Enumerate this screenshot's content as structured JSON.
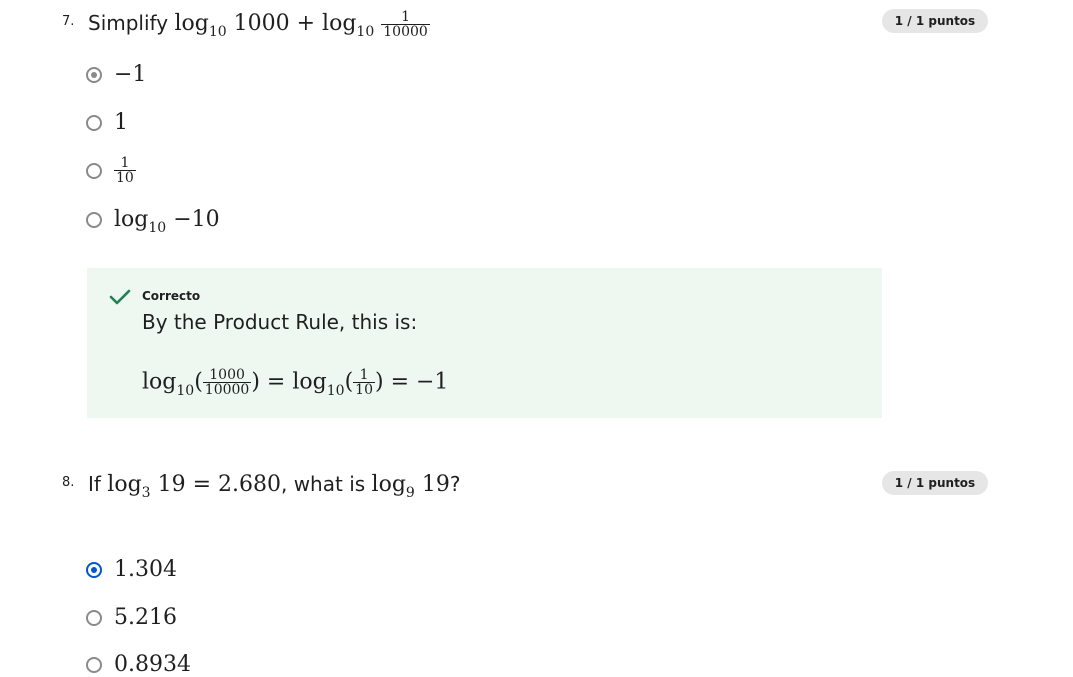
{
  "q7": {
    "number": "7.",
    "prefix": "Simplify ",
    "log_word": "log",
    "log_base": "10",
    "term1": " 1000 + ",
    "frac_num": "1",
    "frac_den": "10000",
    "points": "1 / 1 puntos",
    "options": [
      {
        "label": "−1",
        "selected": true
      },
      {
        "label": "1",
        "selected": false
      },
      {
        "frac_num": "1",
        "frac_den": "10",
        "selected": false
      },
      {
        "log_word": "log",
        "log_base": "10",
        "rest": " −10",
        "selected": false
      }
    ],
    "feedback": {
      "title": "Correcto",
      "text": "By the Product Rule, this is:",
      "eq_frac1_num": "1000",
      "eq_frac1_den": "10000",
      "eq_frac2_num": "1",
      "eq_frac2_den": "10",
      "eq_result": " = −1"
    }
  },
  "q8": {
    "number": "8.",
    "prefix": "If ",
    "base1": "3",
    "eq1": " 19 = 2.680",
    "middle": ", what is ",
    "base2": "9",
    "eq2": " 19",
    "suffix": "?",
    "points": "1 / 1 puntos",
    "options": [
      {
        "label": "1.304",
        "selected": true
      },
      {
        "label": "5.216",
        "selected": false
      },
      {
        "label": "0.8934",
        "selected": false
      }
    ]
  },
  "colors": {
    "accent": "#0056d2",
    "success": "#1f8354",
    "feedback_bg": "#eef8f1",
    "badge_bg": "#e6e6e6"
  }
}
